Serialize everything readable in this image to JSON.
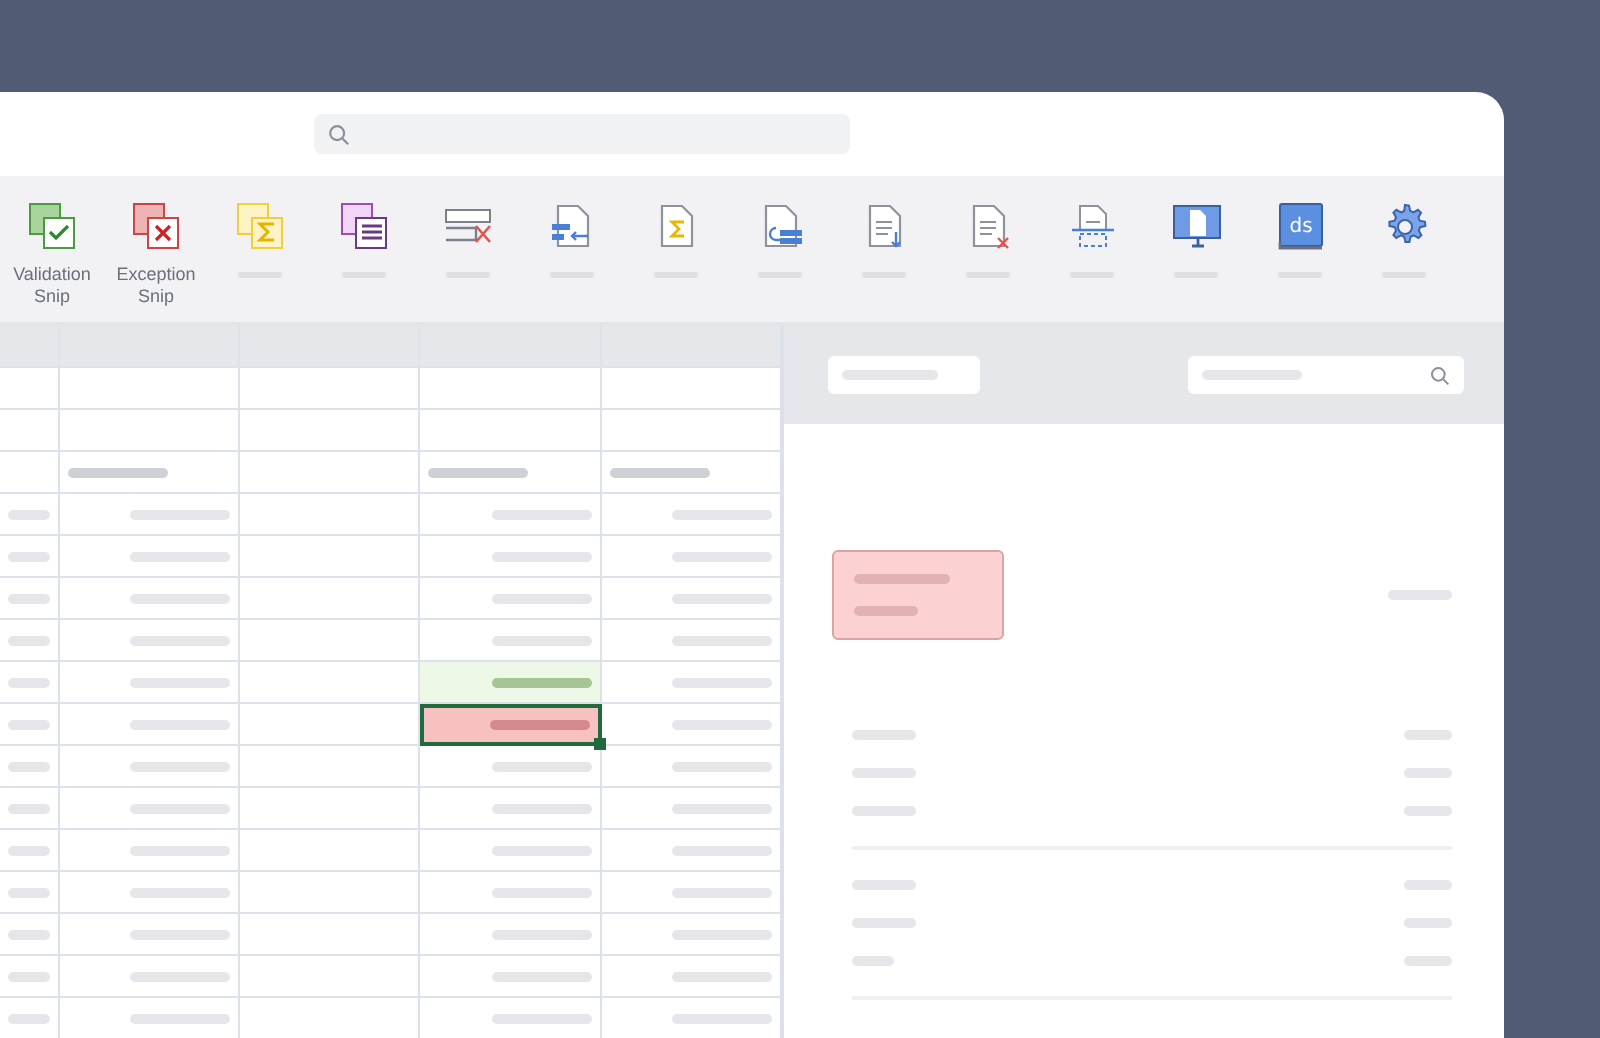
{
  "toolbar": {
    "buttons": [
      {
        "label": "Validation Snip"
      },
      {
        "label": "Exception Snip"
      }
    ],
    "book_icon_text": "ds"
  }
}
